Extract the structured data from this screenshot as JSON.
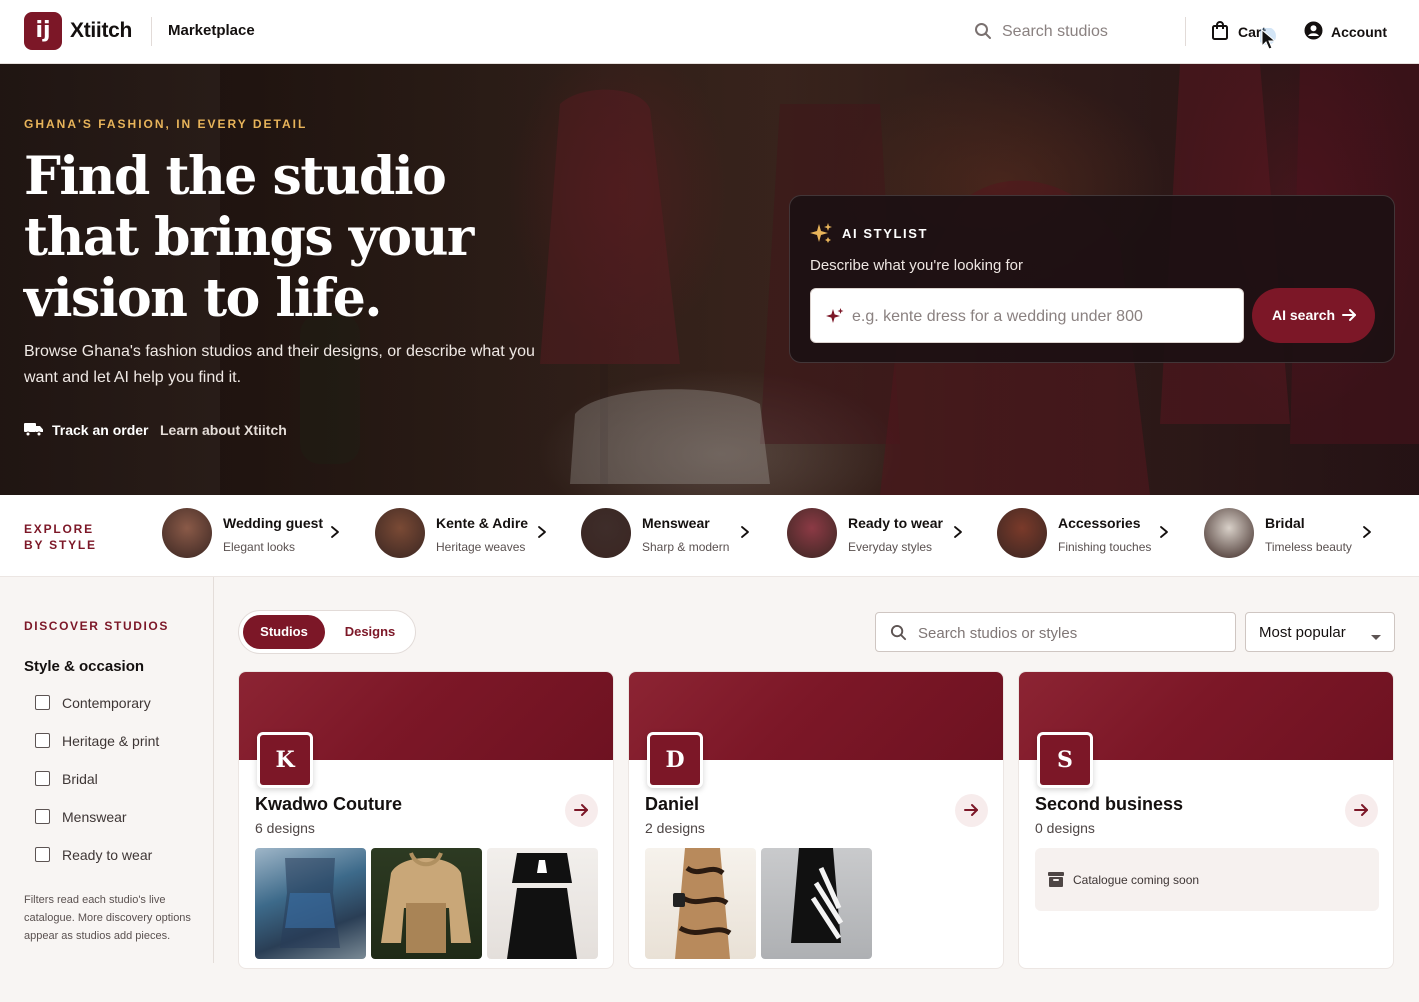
{
  "brand": {
    "logo_letter": "ij",
    "name": "Xtiitch",
    "section": "Marketplace"
  },
  "topbar": {
    "search_placeholder": "Search studios",
    "cart_label": "Cart",
    "account_label": "Account"
  },
  "hero": {
    "eyebrow": "GHANA'S FASHION, IN EVERY DETAIL",
    "title_line1": "Find the studio",
    "title_line2": "that brings your",
    "title_line3": "vision to life.",
    "subtitle": "Browse Ghana's fashion studios and their designs, or describe what you want and let AI help you find it.",
    "track_label": "Track an order",
    "learn_label": "Learn about Xtiitch"
  },
  "ai_stylist": {
    "label": "AI STYLIST",
    "prompt": "Describe what you're looking for",
    "placeholder": "e.g. kente dress for a wedding under 800",
    "button_label": "AI search"
  },
  "explore": {
    "title_line1": "EXPLORE",
    "title_line2": "BY STYLE",
    "items": [
      {
        "name": "Wedding guest",
        "desc": "Elegant looks",
        "thumb_color": "#8a5a48"
      },
      {
        "name": "Kente & Adire",
        "desc": "Heritage weaves",
        "thumb_color": "#7a4a35"
      },
      {
        "name": "Menswear",
        "desc": "Sharp & modern",
        "thumb_color": "#3e2d2a"
      },
      {
        "name": "Ready to wear",
        "desc": "Everyday styles",
        "thumb_color": "#8c3a45"
      },
      {
        "name": "Accessories",
        "desc": "Finishing touches",
        "thumb_color": "#7a3a2a"
      },
      {
        "name": "Bridal",
        "desc": "Timeless beauty",
        "thumb_color": "#d8d0c8"
      }
    ]
  },
  "sidebar": {
    "title": "DISCOVER STUDIOS",
    "heading": "Style & occasion",
    "filters": [
      "Contemporary",
      "Heritage & print",
      "Bridal",
      "Menswear",
      "Ready to wear"
    ],
    "note": "Filters read each studio's live catalogue. More discovery options appear as studios add pieces."
  },
  "main": {
    "tabs": {
      "studios": "Studios",
      "designs": "Designs"
    },
    "search_placeholder": "Search studios or styles",
    "sort_value": "Most popular"
  },
  "studios": [
    {
      "initial": "K",
      "name": "Kwadwo Couture",
      "count": "6 designs"
    },
    {
      "initial": "D",
      "name": "Daniel",
      "count": "2 designs"
    },
    {
      "initial": "S",
      "name": "Second business",
      "count": "0 designs",
      "empty_label": "Catalogue coming soon"
    }
  ],
  "colors": {
    "accent": "#7c1727",
    "gold": "#e8b45a"
  }
}
